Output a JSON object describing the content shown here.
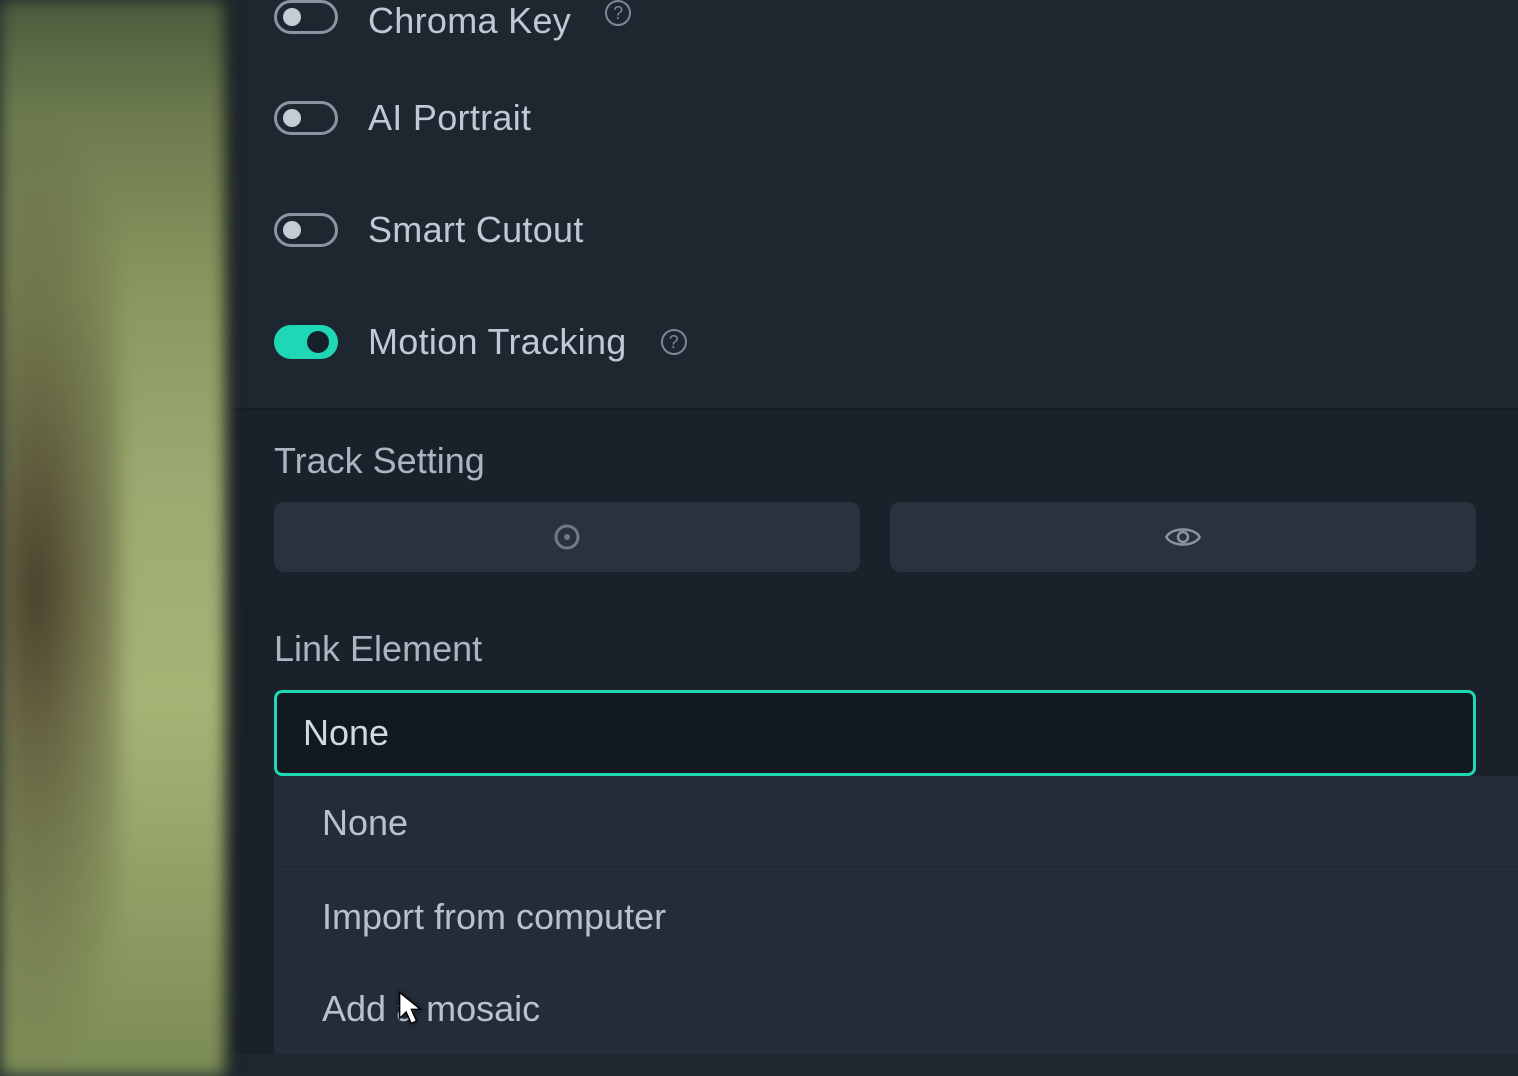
{
  "toggles": {
    "chroma_key": {
      "label": "Chroma Key",
      "enabled": false,
      "has_help": true
    },
    "ai_portrait": {
      "label": "AI Portrait",
      "enabled": false,
      "has_help": false
    },
    "smart_cutout": {
      "label": "Smart Cutout",
      "enabled": false,
      "has_help": false
    },
    "motion_tracking": {
      "label": "Motion Tracking",
      "enabled": true,
      "has_help": true
    }
  },
  "track_setting": {
    "title": "Track Setting"
  },
  "link_element": {
    "title": "Link Element",
    "selected": "None",
    "options": [
      "None",
      "Import from computer",
      "Add a mosaic"
    ]
  },
  "colors": {
    "accent": "#1fd6b5",
    "panel_bg": "#1e2630",
    "input_bg": "#29323d"
  }
}
